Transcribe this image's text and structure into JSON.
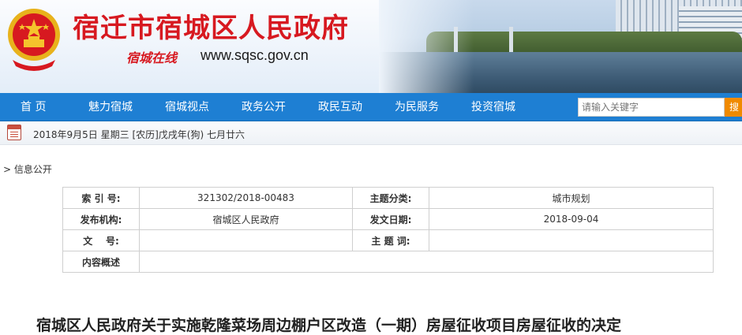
{
  "header": {
    "site_title": "宿迁市宿城区人民政府",
    "slogan": "宿城在线",
    "domain": "www.sqsc.gov.cn"
  },
  "nav": {
    "items": [
      "首  页",
      "魅力宿城",
      "宿城视点",
      "政务公开",
      "政民互动",
      "为民服务",
      "投资宿城"
    ],
    "search_placeholder": "请输入关键字",
    "search_button": "搜"
  },
  "datebar": {
    "text": "2018年9月5日 星期三 [农历]戊戌年(狗) 七月廿六"
  },
  "breadcrumb": "> 信息公开",
  "info": {
    "rows": [
      {
        "l1": "索 引 号:",
        "v1": "321302/2018-00483",
        "l2": "主题分类:",
        "v2": "城市规划"
      },
      {
        "l1": "发布机构:",
        "v1": "宿城区人民政府",
        "l2": "发文日期:",
        "v2": "2018-09-04"
      },
      {
        "l1": "文    号:",
        "v1": "",
        "l2": "主 题 词:",
        "v2": ""
      }
    ],
    "summary_label": "内容概述",
    "summary_value": ""
  },
  "document": {
    "title": "宿城区人民政府关于实施乾隆菜场周边棚户区改造（一期）房屋征收项目房屋征收的决定"
  },
  "colors": {
    "brand_red": "#d71920",
    "nav_blue": "#1e7fd3",
    "search_orange": "#f08a00"
  }
}
